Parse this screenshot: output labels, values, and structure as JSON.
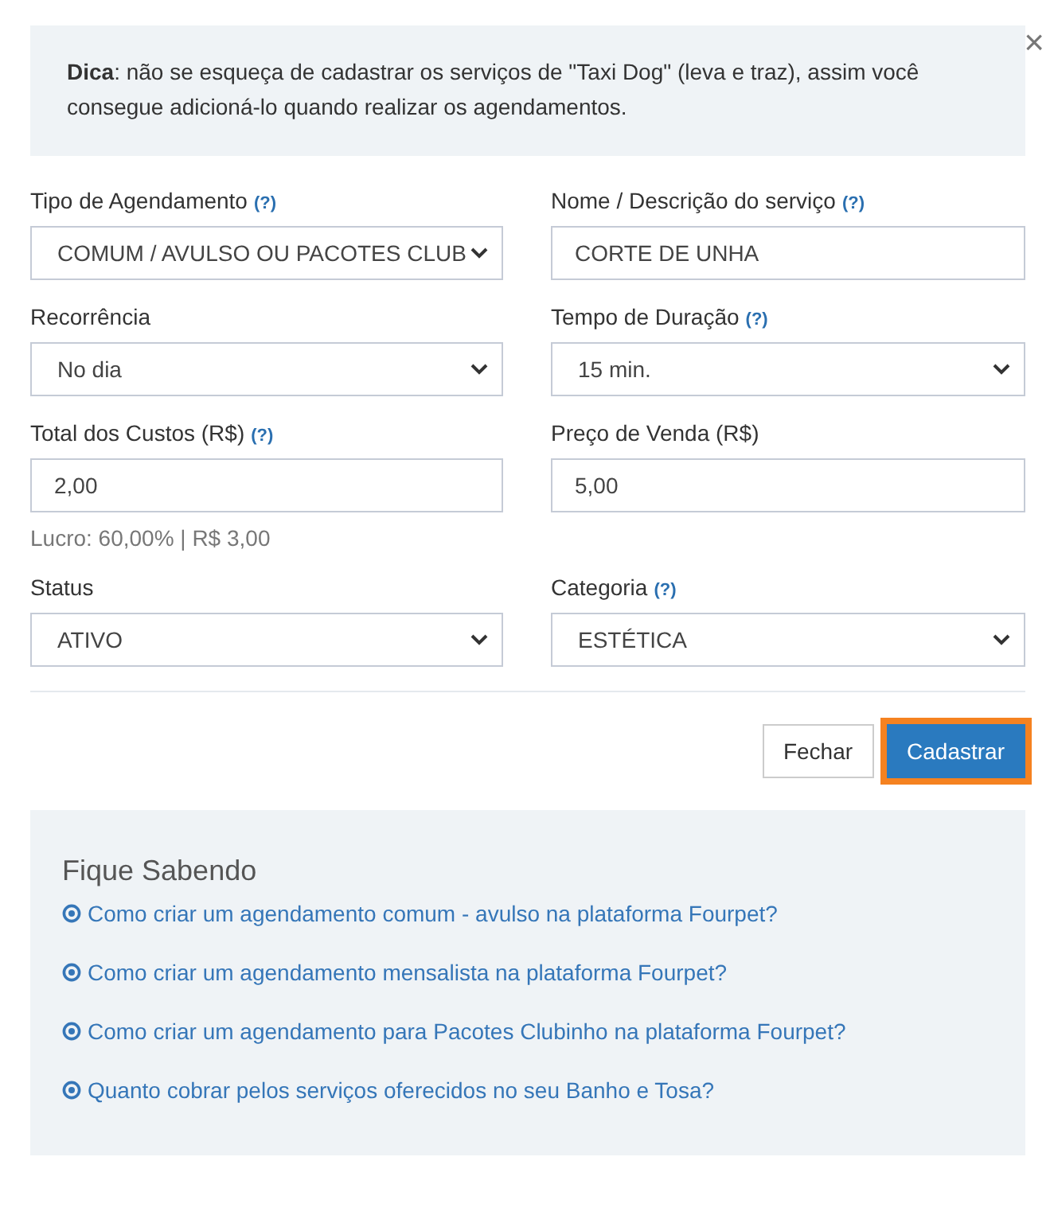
{
  "close": "×",
  "tip": "**Dica**: não se esqueça de cadastrar os serviços de \"Taxi Dog\" (leva e traz), assim você consegue adicioná-lo quando realizar os agendamentos.",
  "form_rows": [
    {
      "fields": [
        {
          "label": "Tipo de Agendamento",
          "help": "(?)",
          "kind": "select",
          "value": "COMUM / AVULSO OU PACOTES CLUB"
        },
        {
          "label": "Nome / Descrição do serviço",
          "help": "(?)",
          "kind": "input",
          "value": "CORTE DE UNHA"
        }
      ]
    },
    {
      "fields": [
        {
          "label": "Recorrência",
          "kind": "select",
          "value": "No dia"
        },
        {
          "label": "Tempo de Duração",
          "help": "(?)",
          "kind": "select",
          "value": "15 min."
        }
      ]
    },
    {
      "fields": [
        {
          "label": "Total dos Custos (R$)",
          "help": "(?)",
          "kind": "input",
          "value": "2,00",
          "note": "Lucro: 60,00% | R$ 3,00"
        },
        {
          "label": "Preço de Venda (R$)",
          "kind": "input",
          "value": "5,00"
        }
      ]
    },
    {
      "fields": [
        {
          "label": "Status",
          "kind": "select",
          "value": "ATIVO"
        },
        {
          "label": "Categoria",
          "help": "(?)",
          "kind": "select",
          "value": "ESTÉTICA"
        }
      ]
    }
  ],
  "buttons": [
    {
      "label": "Fechar",
      "kind": "default",
      "focused": false
    },
    {
      "label": "Cadastrar",
      "kind": "primary",
      "focused": true
    }
  ],
  "info": {
    "title": "Fique Sabendo",
    "links": [
      "Como criar um agendamento comum - avulso na plataforma Fourpet?",
      "Como criar um agendamento mensalista na plataforma Fourpet?",
      "Como criar um agendamento para Pacotes Clubinho na plataforma Fourpet?",
      "Quanto cobrar pelos serviços oferecidos no seu Banho e Tosa?"
    ]
  }
}
